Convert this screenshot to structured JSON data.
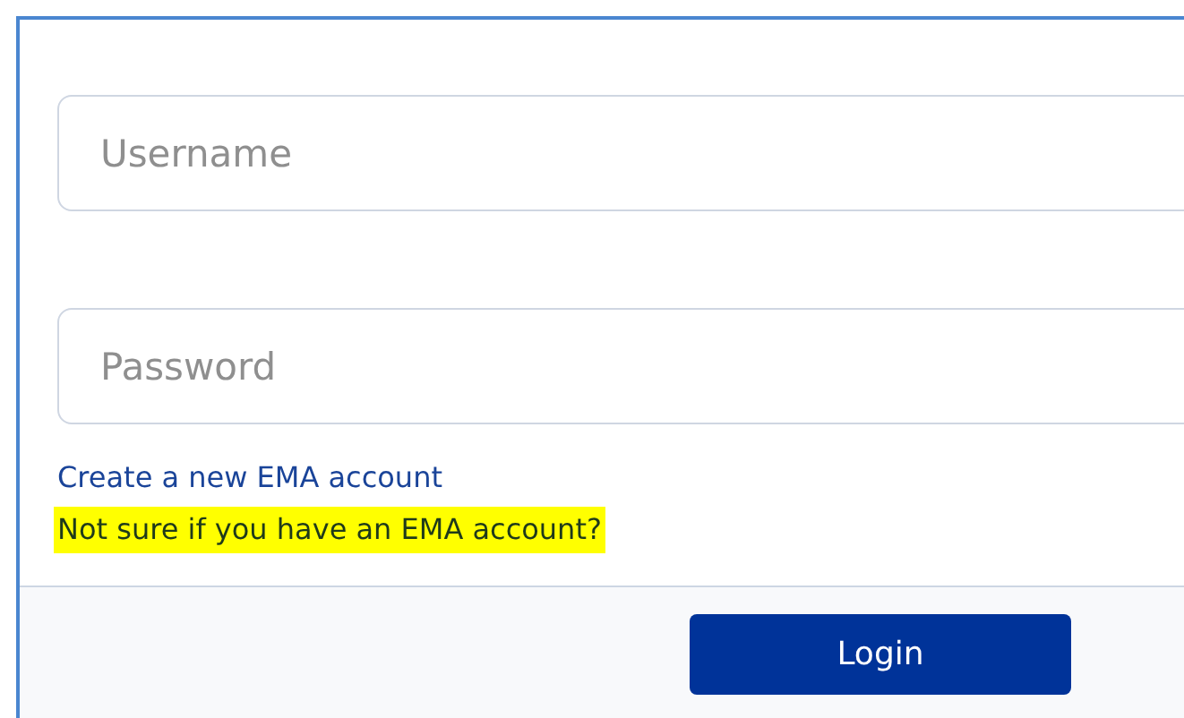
{
  "fields": [
    {
      "placeholder": "Username"
    },
    {
      "placeholder": "Password"
    }
  ],
  "links": [
    {
      "label": "Create a new EMA account",
      "highlighted": false
    },
    {
      "label": "Not sure if you have an EMA account?",
      "highlighted": true
    }
  ],
  "buttons": [
    "Login"
  ]
}
